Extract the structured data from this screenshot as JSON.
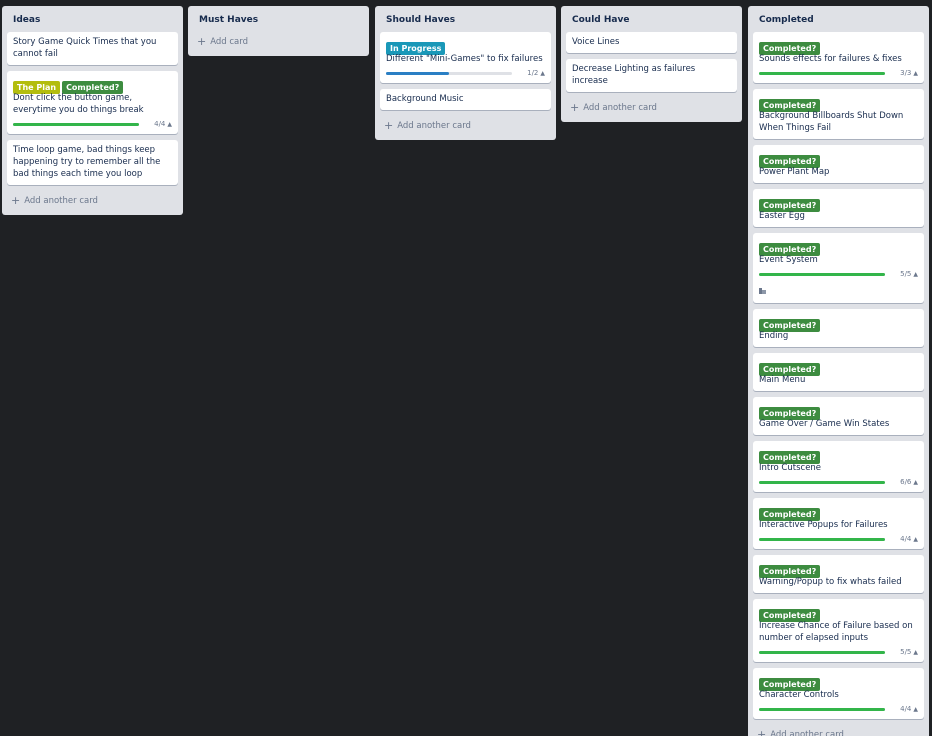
{
  "colors": {
    "background": "#1f2124",
    "list_bg": "#dfe1e6",
    "label_green": "#3d8c40",
    "label_lime": "#b3bd0e",
    "label_teal": "#1a98b8",
    "progress_green": "#33b54a",
    "progress_blue": "#2a7fc4"
  },
  "lists": [
    {
      "title": "Ideas",
      "add_label": "Add another card",
      "cards": [
        {
          "text": "Story Game Quick Times that you cannot fail"
        },
        {
          "labels": [
            {
              "text": "The Plan",
              "color": "#b3bd0e"
            },
            {
              "text": "Completed?",
              "color": "#3d8c40"
            }
          ],
          "text": "Dont click the button game, everytime you do things break",
          "checklist": {
            "count": "4/4",
            "progress": 1.0,
            "color": "#33b54a"
          }
        },
        {
          "text": "Time loop game, bad things keep happening try to remember all the bad things each time you loop"
        }
      ]
    },
    {
      "title": "Must Haves",
      "add_label": "Add card",
      "cards": []
    },
    {
      "title": "Should Haves",
      "add_label": "Add another card",
      "cards": [
        {
          "labels": [
            {
              "text": "In Progress",
              "color": "#1a98b8"
            }
          ],
          "text": "Different \"Mini-Games\" to fix failures",
          "checklist": {
            "count": "1/2",
            "progress": 0.5,
            "color": "#2a7fc4"
          }
        },
        {
          "text": "Background Music"
        }
      ]
    },
    {
      "title": "Could Have",
      "add_label": "Add another card",
      "cards": [
        {
          "text": "Voice Lines"
        },
        {
          "text": "Decrease Lighting as failures increase"
        }
      ]
    },
    {
      "title": "Completed",
      "add_label": "Add another card",
      "cards": [
        {
          "labels": [
            {
              "text": "Completed?",
              "color": "#3d8c40"
            }
          ],
          "text": "Sounds effects for failures & fixes",
          "checklist": {
            "count": "3/3",
            "progress": 1.0,
            "color": "#33b54a"
          }
        },
        {
          "labels": [
            {
              "text": "Completed?",
              "color": "#3d8c40"
            }
          ],
          "text": "Background Billboards Shut Down When Things Fail"
        },
        {
          "labels": [
            {
              "text": "Completed?",
              "color": "#3d8c40"
            }
          ],
          "text": "Power Plant Map"
        },
        {
          "labels": [
            {
              "text": "Completed?",
              "color": "#3d8c40"
            }
          ],
          "text": "Easter Egg"
        },
        {
          "labels": [
            {
              "text": "Completed?",
              "color": "#3d8c40"
            }
          ],
          "text": "Event System",
          "checklist": {
            "count": "5/5",
            "progress": 1.0,
            "color": "#33b54a"
          },
          "description_icon": "description-icon"
        },
        {
          "labels": [
            {
              "text": "Completed?",
              "color": "#3d8c40"
            }
          ],
          "text": "Ending"
        },
        {
          "labels": [
            {
              "text": "Completed?",
              "color": "#3d8c40"
            }
          ],
          "text": "Main Menu"
        },
        {
          "labels": [
            {
              "text": "Completed?",
              "color": "#3d8c40"
            }
          ],
          "text": "Game Over / Game Win States"
        },
        {
          "labels": [
            {
              "text": "Completed?",
              "color": "#3d8c40"
            }
          ],
          "text": "Intro Cutscene",
          "checklist": {
            "count": "6/6",
            "progress": 1.0,
            "color": "#33b54a"
          }
        },
        {
          "labels": [
            {
              "text": "Completed?",
              "color": "#3d8c40"
            }
          ],
          "text": "Interactive Popups for Failures",
          "checklist": {
            "count": "4/4",
            "progress": 1.0,
            "color": "#33b54a"
          }
        },
        {
          "labels": [
            {
              "text": "Completed?",
              "color": "#3d8c40"
            }
          ],
          "text": "Warning/Popup to fix whats failed"
        },
        {
          "labels": [
            {
              "text": "Completed?",
              "color": "#3d8c40"
            }
          ],
          "text": "Increase Chance of Failure based on number of elapsed inputs",
          "checklist": {
            "count": "5/5",
            "progress": 1.0,
            "color": "#33b54a"
          }
        },
        {
          "labels": [
            {
              "text": "Completed?",
              "color": "#3d8c40"
            }
          ],
          "text": "Character Controls",
          "checklist": {
            "count": "4/4",
            "progress": 1.0,
            "color": "#33b54a"
          }
        }
      ]
    }
  ]
}
